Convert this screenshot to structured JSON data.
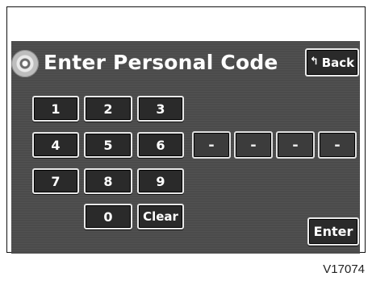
{
  "title": "Enter Personal Code",
  "back": {
    "arrow": "↰",
    "label": "Back"
  },
  "keypad": {
    "k1": "1",
    "k2": "2",
    "k3": "3",
    "k4": "4",
    "k5": "5",
    "k6": "6",
    "k7": "7",
    "k8": "8",
    "k9": "9",
    "k0": "0",
    "clear": "Clear"
  },
  "code_slots": [
    "-",
    "-",
    "-",
    "-"
  ],
  "enter_label": "Enter",
  "caption": "V17074",
  "colors": {
    "screen_bg": "#4b4b4b",
    "button_fill": "#2a2a2a",
    "button_border": "#e9e9e9",
    "text": "#ffffff"
  }
}
